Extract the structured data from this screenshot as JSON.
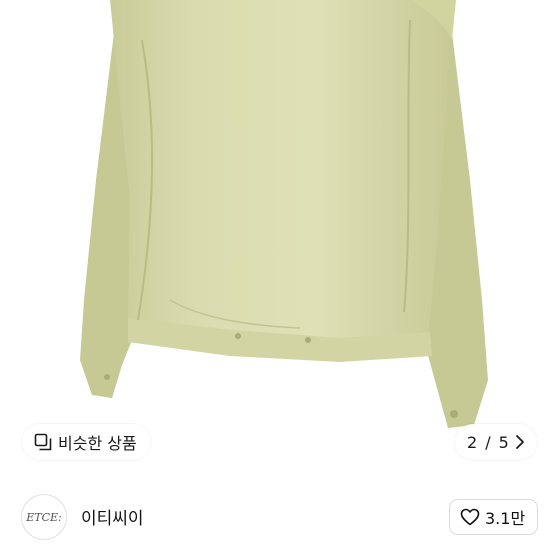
{
  "similar_products": {
    "label": "비슷한 상품",
    "icon": "similar-items-icon"
  },
  "pager": {
    "current": "2",
    "separator": "/",
    "total": "5",
    "next_icon": "chevron-right-icon"
  },
  "seller": {
    "avatar_text": "ETCE:",
    "name": "이티씨이"
  },
  "like": {
    "count": "3.1만",
    "icon": "heart-icon"
  },
  "colors": {
    "jacket": "#d7d9ac",
    "background": "#ffffff",
    "text": "#111111"
  }
}
